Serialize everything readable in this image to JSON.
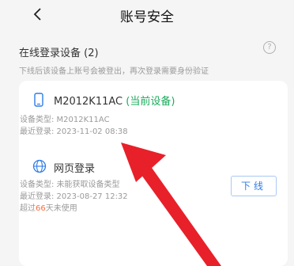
{
  "header": {
    "title": "账号安全"
  },
  "section": {
    "title": "在线登录设备 (2)",
    "subtitle": "下线后该设备上账号会被登出，再次登录需要身份验证"
  },
  "devices": [
    {
      "name": "M2012K11AC",
      "current_tag": "(当前设备)",
      "type": "设备类型: M2012K11AC",
      "last_login": "最近登录: 2023-11-02 08:38"
    },
    {
      "name": "网页登录",
      "type": "设备类型: 未能获取设备类型",
      "last_login": "最近登录: 2023-08-27 12:32",
      "unused_prefix": "超过",
      "unused_days": "66",
      "unused_suffix": "天未使用",
      "logout_label": "下线"
    }
  ],
  "colors": {
    "current": "#1aab5c",
    "logout": "#2f7ce8",
    "annotation_arrow": "#e8202a"
  }
}
